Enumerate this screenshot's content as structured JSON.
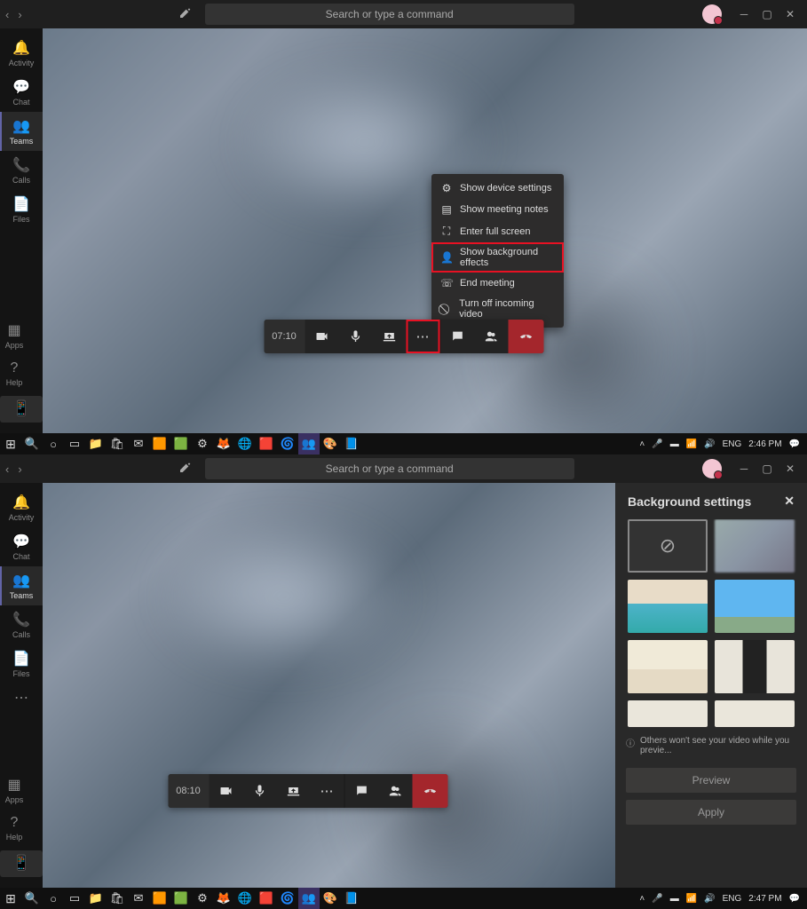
{
  "shot1": {
    "search_placeholder": "Search or type a command",
    "sidebar": [
      "Activity",
      "Chat",
      "Teams",
      "Calls",
      "Files"
    ],
    "sidebar_bottom": [
      "Apps",
      "Help"
    ],
    "call_timer": "07:10",
    "menu": {
      "device": "Show device settings",
      "notes": "Show meeting notes",
      "full": "Enter full screen",
      "bg": "Show background effects",
      "end": "End meeting",
      "incoming": "Turn off incoming video"
    },
    "taskbar_lang": "ENG",
    "taskbar_time": "2:46 PM"
  },
  "shot2": {
    "search_placeholder": "Search or type a command",
    "sidebar": [
      "Activity",
      "Chat",
      "Teams",
      "Calls",
      "Files"
    ],
    "sidebar_bottom": [
      "Apps",
      "Help"
    ],
    "call_timer": "08:10",
    "panel": {
      "title": "Background settings",
      "note": "Others won't see your video while you previe...",
      "preview": "Preview",
      "apply": "Apply"
    },
    "taskbar_lang": "ENG",
    "taskbar_time": "2:47 PM"
  }
}
